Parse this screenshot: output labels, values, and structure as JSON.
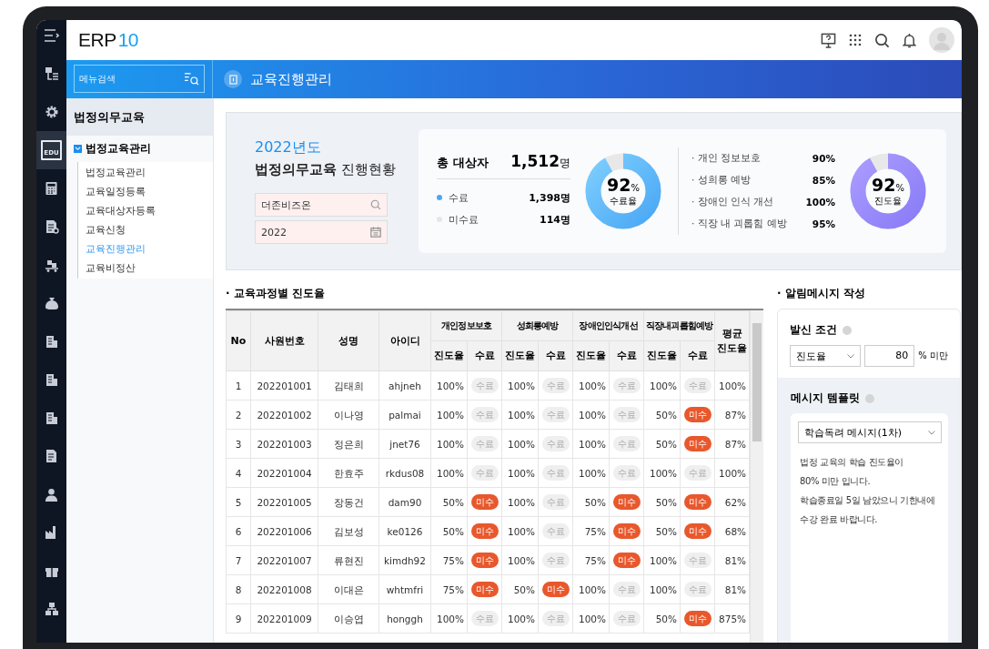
{
  "rail": {
    "items": [
      {
        "selected": false
      },
      {
        "selected": false
      },
      {
        "selected": true,
        "label": "EDU"
      },
      {
        "selected": false
      },
      {
        "selected": false
      },
      {
        "selected": false
      },
      {
        "selected": false
      },
      {
        "selected": false
      },
      {
        "selected": false
      },
      {
        "selected": false
      },
      {
        "selected": false
      },
      {
        "selected": false
      },
      {
        "selected": false
      },
      {
        "selected": false
      },
      {
        "selected": false
      }
    ]
  },
  "header": {
    "logo": "ERP",
    "logo_num": "10"
  },
  "search": {
    "placeholder": "메뉴검색"
  },
  "page_title": "교육진행관리",
  "sidebar": {
    "section": "법정의무교육",
    "tree": [
      {
        "label": "법정교육관리",
        "expanded": true,
        "children": [
          {
            "label": "법정교육관리",
            "selected": false
          },
          {
            "label": "교육일정등록",
            "selected": false
          },
          {
            "label": "교육대상자등록",
            "selected": false
          },
          {
            "label": "교육신청",
            "selected": false
          },
          {
            "label": "교육진행관리",
            "selected": true
          },
          {
            "label": "교육비정산",
            "selected": false
          }
        ]
      }
    ]
  },
  "summary": {
    "year": "2022년도",
    "title": "**법정의무교육** 진행현황",
    "company": "더존비즈온",
    "year_field": "2022",
    "total_label": "총 대상자",
    "total_value": "1,512",
    "total_unit": "명",
    "legend": [
      {
        "label": "수료",
        "value": "1,398명",
        "color": "#4aa8f5"
      },
      {
        "label": "미수료",
        "value": "114명",
        "color": "#e6e6e6"
      }
    ],
    "ring1": {
      "value": "92",
      "unit": "%",
      "caption": "수료율",
      "level": 0.92
    },
    "courses": [
      {
        "label": "· 개인 정보보호",
        "value": "90%"
      },
      {
        "label": "· 성희롱 예방",
        "value": "85%"
      },
      {
        "label": "· 장애인 인식 개선",
        "value": "100%"
      },
      {
        "label": "· 직장 내 괴롭힘 예방",
        "value": "95%"
      }
    ],
    "ring2": {
      "value": "92",
      "unit": "%",
      "caption": "진도율",
      "level": 0.92
    }
  },
  "table": {
    "title": "· 교육과정별 진도율",
    "columns": [
      "No",
      "사원번호",
      "성명",
      "아이디"
    ],
    "groups": [
      {
        "label": "개인정보보호",
        "sub": [
          "진도율",
          "수료"
        ]
      },
      {
        "label": "성희롱예방",
        "sub": [
          "진도율",
          "수료"
        ]
      },
      {
        "label": "장애인인식개선",
        "sub": [
          "진도율",
          "수료"
        ]
      },
      {
        "label": "직장내괴롭힘예방",
        "sub": [
          "진도율",
          "수료"
        ]
      }
    ],
    "avg": "평균\n진도율",
    "rows": [
      {
        "no": "1",
        "emp": "202201001",
        "name": "김태희",
        "id": "ahjneh",
        "cells": [
          [
            "100%",
            "수료",
            true
          ],
          [
            "100%",
            "수료",
            true
          ],
          [
            "100%",
            "수료",
            true
          ],
          [
            "100%",
            "수료",
            true
          ]
        ],
        "avg": "100%"
      },
      {
        "no": "2",
        "emp": "202201002",
        "name": "이나영",
        "id": "palmai",
        "cells": [
          [
            "100%",
            "수료",
            true
          ],
          [
            "100%",
            "수료",
            true
          ],
          [
            "100%",
            "수료",
            true
          ],
          [
            "50%",
            "미수",
            false
          ]
        ],
        "avg": "87%"
      },
      {
        "no": "3",
        "emp": "202201003",
        "name": "정은희",
        "id": "jnet76",
        "cells": [
          [
            "100%",
            "수료",
            true
          ],
          [
            "100%",
            "수료",
            true
          ],
          [
            "100%",
            "수료",
            true
          ],
          [
            "50%",
            "미수",
            false
          ]
        ],
        "avg": "87%"
      },
      {
        "no": "4",
        "emp": "202201004",
        "name": "한효주",
        "id": "rkdus08",
        "cells": [
          [
            "100%",
            "수료",
            true
          ],
          [
            "100%",
            "수료",
            true
          ],
          [
            "100%",
            "수료",
            true
          ],
          [
            "100%",
            "수료",
            true
          ]
        ],
        "avg": "100%"
      },
      {
        "no": "5",
        "emp": "202201005",
        "name": "장동건",
        "id": "dam90",
        "cells": [
          [
            "50%",
            "미수",
            false
          ],
          [
            "100%",
            "수료",
            true
          ],
          [
            "50%",
            "미수",
            false
          ],
          [
            "50%",
            "미수",
            false
          ]
        ],
        "avg": "62%"
      },
      {
        "no": "6",
        "emp": "202201006",
        "name": "김보성",
        "id": "ke0126",
        "cells": [
          [
            "50%",
            "미수",
            false
          ],
          [
            "100%",
            "수료",
            true
          ],
          [
            "75%",
            "미수",
            false
          ],
          [
            "50%",
            "미수",
            false
          ]
        ],
        "avg": "68%"
      },
      {
        "no": "7",
        "emp": "202201007",
        "name": "류현진",
        "id": "kimdh92",
        "cells": [
          [
            "75%",
            "미수",
            false
          ],
          [
            "100%",
            "수료",
            true
          ],
          [
            "75%",
            "미수",
            false
          ],
          [
            "100%",
            "수료",
            true
          ]
        ],
        "avg": "81%"
      },
      {
        "no": "8",
        "emp": "202201008",
        "name": "이대은",
        "id": "whtmfri",
        "cells": [
          [
            "75%",
            "미수",
            false
          ],
          [
            "50%",
            "미수",
            false
          ],
          [
            "100%",
            "수료",
            true
          ],
          [
            "100%",
            "수료",
            true
          ]
        ],
        "avg": "81%"
      },
      {
        "no": "9",
        "emp": "202201009",
        "name": "이승엽",
        "id": "honggh",
        "cells": [
          [
            "100%",
            "수료",
            true
          ],
          [
            "100%",
            "수료",
            true
          ],
          [
            "100%",
            "수료",
            true
          ],
          [
            "50%",
            "미수",
            false
          ]
        ],
        "avg": "875%"
      }
    ]
  },
  "alert": {
    "title": "· 알림메시지 작성",
    "condition_label": "발신 조건",
    "condition_select": "진도율",
    "threshold": "80",
    "threshold_unit": "% 미만",
    "template_label": "메시지 템플릿",
    "template_select": "학습독려 메시지(1차)",
    "message": "법정 교육의 학습 진도율이\n80% 미만 입니다.\n학습종료일 5일 남았으니 기한내에\n수강 완료 바랍니다."
  }
}
